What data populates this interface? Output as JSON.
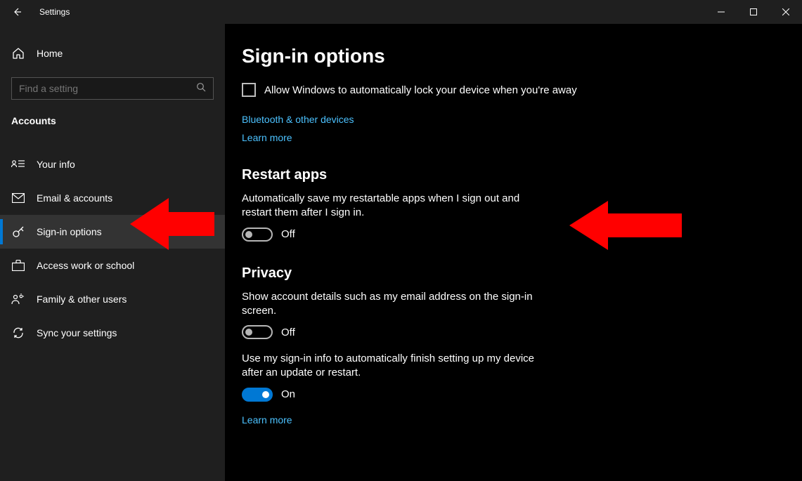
{
  "window": {
    "title": "Settings"
  },
  "sidebar": {
    "home": "Home",
    "search_placeholder": "Find a setting",
    "group": "Accounts",
    "items": [
      {
        "label": "Your info"
      },
      {
        "label": "Email & accounts"
      },
      {
        "label": "Sign-in options"
      },
      {
        "label": "Access work or school"
      },
      {
        "label": "Family & other users"
      },
      {
        "label": "Sync your settings"
      }
    ]
  },
  "content": {
    "title": "Sign-in options",
    "lock_checkbox": "Allow Windows to automatically lock your device when you're away",
    "bluetooth_link": "Bluetooth & other devices",
    "learn_more": "Learn more",
    "restart_heading": "Restart apps",
    "restart_desc": "Automatically save my restartable apps when I sign out and restart them after I sign in.",
    "restart_toggle": "Off",
    "privacy_heading": "Privacy",
    "privacy_desc1": "Show account details such as my email address on the sign-in screen.",
    "privacy_toggle1": "Off",
    "privacy_desc2": "Use my sign-in info to automatically finish setting up my device after an update or restart.",
    "privacy_toggle2": "On",
    "learn_more2": "Learn more"
  }
}
